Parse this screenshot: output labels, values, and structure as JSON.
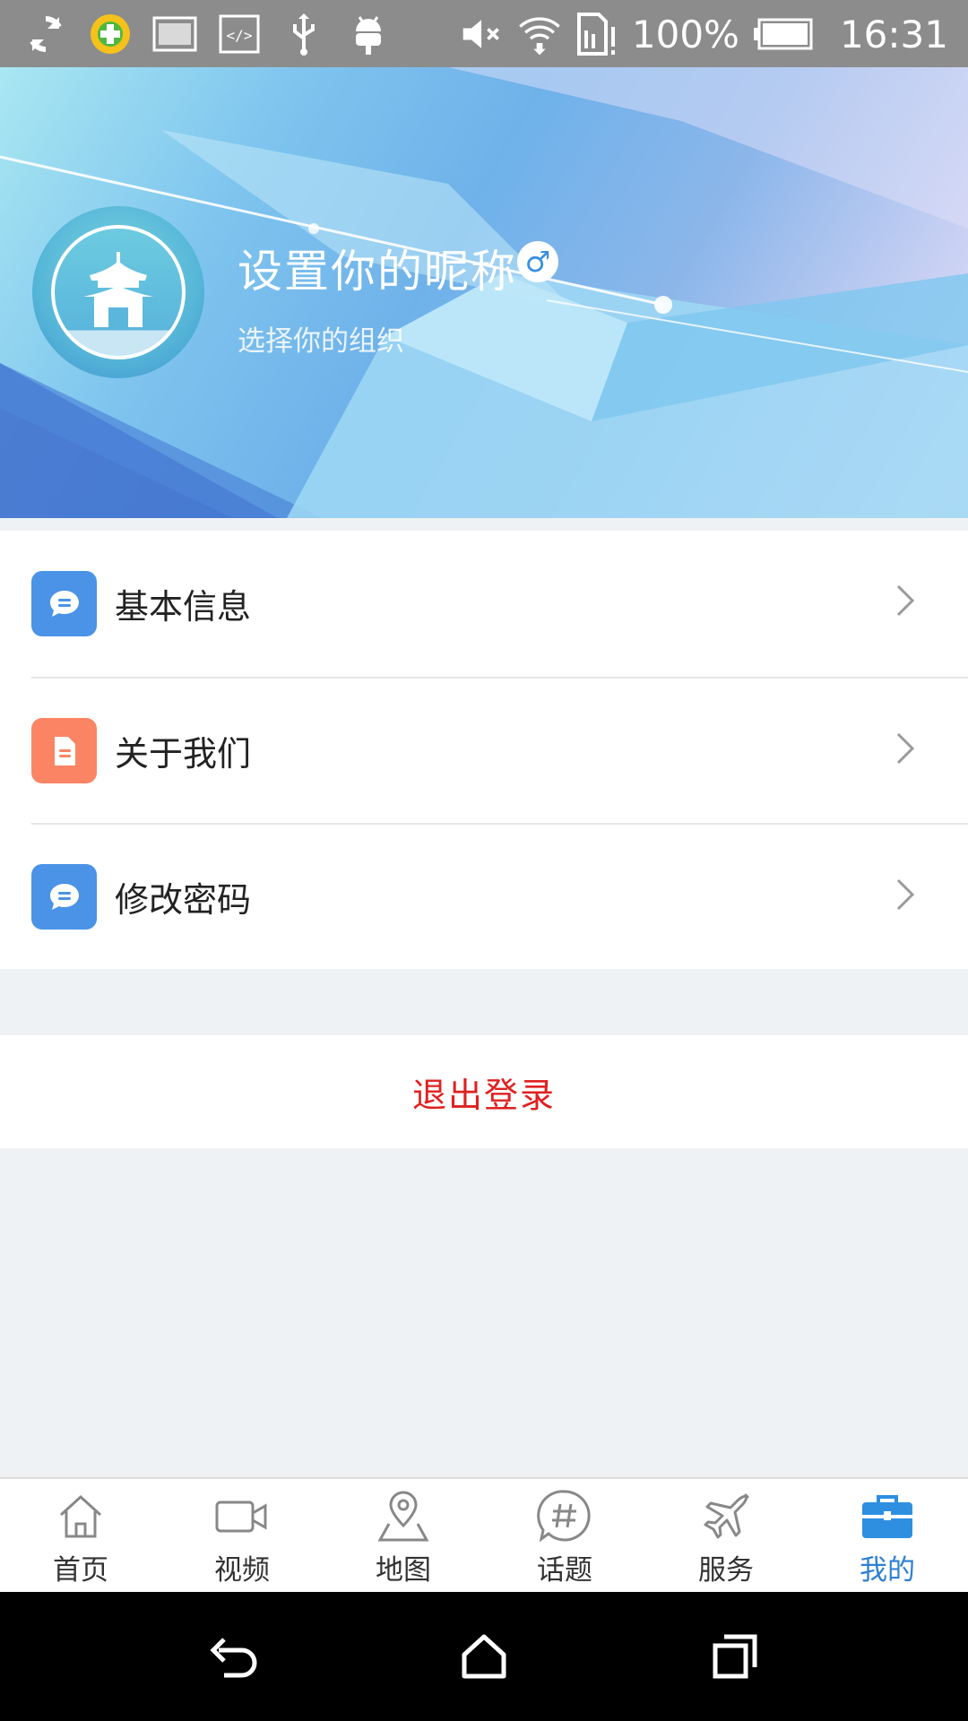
{
  "status_bar": {
    "battery_percent": "100%",
    "time": "16:31",
    "icons": [
      "sync-icon",
      "security-app-icon",
      "image-icon",
      "code-icon",
      "usb-icon",
      "android-icon",
      "mute-icon",
      "wifi-icon",
      "sim-alert-icon",
      "battery-icon"
    ]
  },
  "profile": {
    "nickname": "设置你的昵称",
    "gender_symbol": "♂",
    "subtitle": "选择你的组织"
  },
  "menu": {
    "items": [
      {
        "label": "基本信息",
        "icon": "chat-bubble-icon",
        "color": "#4a93e6"
      },
      {
        "label": "关于我们",
        "icon": "document-icon",
        "color": "#fb8464"
      },
      {
        "label": "修改密码",
        "icon": "chat-bubble-icon",
        "color": "#4a93e6"
      }
    ]
  },
  "logout": {
    "label": "退出登录",
    "color": "#e02020"
  },
  "tabbar": {
    "active_color": "#2e7fd4",
    "tabs": [
      {
        "label": "首页",
        "icon": "home-icon"
      },
      {
        "label": "视频",
        "icon": "video-camera-icon"
      },
      {
        "label": "地图",
        "icon": "map-pin-icon"
      },
      {
        "label": "话题",
        "icon": "hashtag-icon"
      },
      {
        "label": "服务",
        "icon": "airplane-icon"
      },
      {
        "label": "我的",
        "icon": "briefcase-icon",
        "active": true
      }
    ]
  },
  "navbar": {
    "buttons": [
      "back-icon",
      "home-nav-icon",
      "recents-icon"
    ]
  }
}
